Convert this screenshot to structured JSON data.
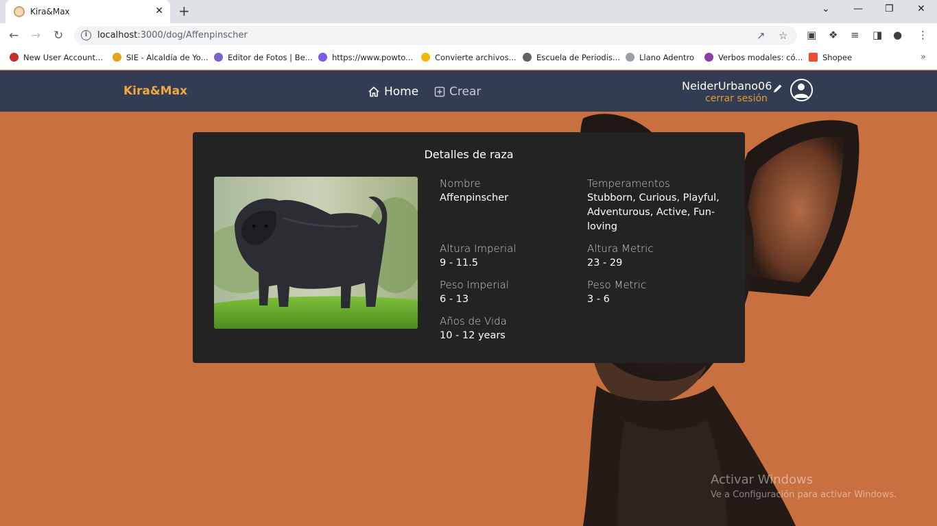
{
  "browser": {
    "tab_title": "Kira&Max",
    "tab_close": "✕",
    "new_tab": "+",
    "url_host": "localhost",
    "url_path": ":3000/dog/Affenpinscher",
    "window_controls": [
      "⌄",
      "—",
      "❐",
      "✕"
    ],
    "bookmarks": [
      {
        "label": "New User Account...",
        "icon": "gear-red-icon",
        "color": "#c4302b"
      },
      {
        "label": "SIE - Alcaldía de Yo...",
        "icon": "s-icon",
        "color": "#e8a11c"
      },
      {
        "label": "Editor de Fotos | Be...",
        "icon": "photo-editor-icon",
        "color": "#7b61c9"
      },
      {
        "label": "https://www.powto...",
        "icon": "powtoon-icon",
        "color": "#7a5ce6"
      },
      {
        "label": "Convierte archivos...",
        "icon": "convert-icon",
        "color": "#f2b705"
      },
      {
        "label": "Escuela de Periodis...",
        "icon": "globe-icon",
        "color": "#5f6368"
      },
      {
        "label": "Llano Adentro",
        "icon": "doc-icon",
        "color": "#9aa0a6"
      },
      {
        "label": "Verbos modales: có...",
        "icon": "verbs-icon",
        "color": "#8e3fa7"
      },
      {
        "label": "Shopee",
        "icon": "shopee-icon",
        "color": "#ee4d2d"
      }
    ],
    "bookmarks_more": "»"
  },
  "nav": {
    "brand": "Kira&Max",
    "home": "Home",
    "create": "Crear",
    "username": "NeiderUrbano06",
    "logout": "cerrar sesión"
  },
  "card": {
    "title": "Detalles de raza",
    "nombre_label": "Nombre",
    "nombre_value": "Affenpinscher",
    "temperamentos_label": "Temperamentos",
    "temperamentos_value": "Stubborn, Curious, Playful, Adventurous, Active, Fun-loving",
    "altura_imperial_label": "Altura Imperial",
    "altura_imperial_value": "9 - 11.5",
    "altura_metric_label": "Altura Metric",
    "altura_metric_value": "23 - 29",
    "peso_imperial_label": "Peso Imperial",
    "peso_imperial_value": "6 - 13",
    "peso_metric_label": "Peso Metric",
    "peso_metric_value": "3 - 6",
    "vida_label": "Años de Vida",
    "vida_value": "10 - 12 years"
  },
  "watermark": {
    "line1": "Activar Windows",
    "line2": "Ve a Configuración para activar Windows."
  },
  "colors": {
    "background": "#c8703f",
    "navbar": "#323c53",
    "brand": "#f0a93c",
    "logout": "#e09d35",
    "card": "#232323"
  }
}
